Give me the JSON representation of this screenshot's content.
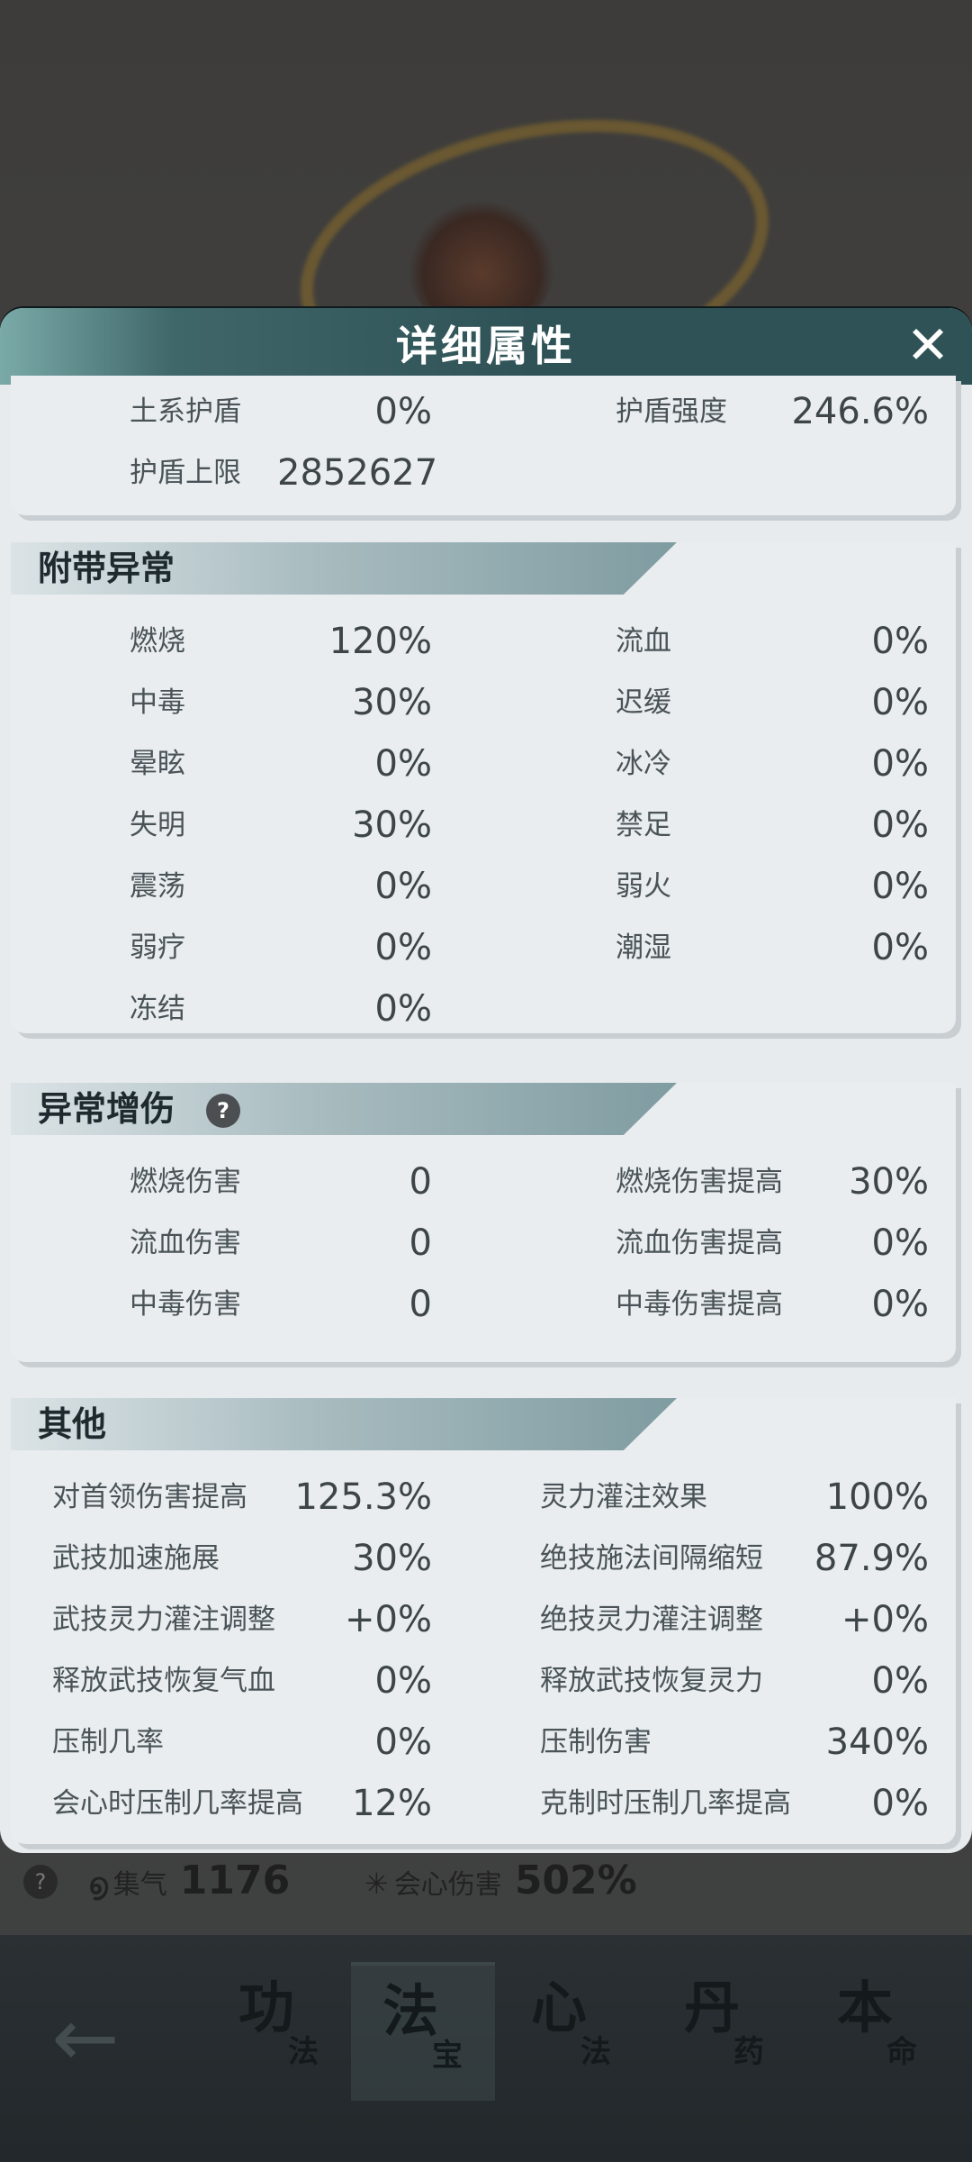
{
  "panel": {
    "title": "详细属性"
  },
  "shield": {
    "rows": [
      {
        "left_label": "土系护盾",
        "left_value": "0%",
        "right_label": "护盾强度",
        "right_value": "246.6%"
      },
      {
        "left_label": "护盾上限",
        "left_value": "2852627",
        "right_label": "",
        "right_value": ""
      }
    ]
  },
  "abnormal": {
    "title": "附带异常",
    "rows": [
      {
        "left_label": "燃烧",
        "left_value": "120%",
        "right_label": "流血",
        "right_value": "0%"
      },
      {
        "left_label": "中毒",
        "left_value": "30%",
        "right_label": "迟缓",
        "right_value": "0%"
      },
      {
        "left_label": "晕眩",
        "left_value": "0%",
        "right_label": "冰冷",
        "right_value": "0%"
      },
      {
        "left_label": "失明",
        "left_value": "30%",
        "right_label": "禁足",
        "right_value": "0%"
      },
      {
        "left_label": "震荡",
        "left_value": "0%",
        "right_label": "弱火",
        "right_value": "0%"
      },
      {
        "left_label": "弱疗",
        "left_value": "0%",
        "right_label": "潮湿",
        "right_value": "0%"
      },
      {
        "left_label": "冻结",
        "left_value": "0%",
        "right_label": "",
        "right_value": ""
      }
    ]
  },
  "abnormal_dmg": {
    "title": "异常增伤",
    "help": "?",
    "rows": [
      {
        "left_label": "燃烧伤害",
        "left_value": "0",
        "right_label": "燃烧伤害提高",
        "right_value": "30%"
      },
      {
        "left_label": "流血伤害",
        "left_value": "0",
        "right_label": "流血伤害提高",
        "right_value": "0%"
      },
      {
        "left_label": "中毒伤害",
        "left_value": "0",
        "right_label": "中毒伤害提高",
        "right_value": "0%"
      }
    ]
  },
  "other": {
    "title": "其他",
    "rows": [
      {
        "left_label": "对首领伤害提高",
        "left_value": "125.3%",
        "right_label": "灵力灌注效果",
        "right_value": "100%"
      },
      {
        "left_label": "武技加速施展",
        "left_value": "30%",
        "right_label": "绝技施法间隔缩短",
        "right_value": "87.9%"
      },
      {
        "left_label": "武技灵力灌注调整",
        "left_value": "+0%",
        "right_label": "绝技灵力灌注调整",
        "right_value": "+0%"
      },
      {
        "left_label": "释放武技恢复气血",
        "left_value": "0%",
        "right_label": "释放武技恢复灵力",
        "right_value": "0%"
      },
      {
        "left_label": "压制几率",
        "left_value": "0%",
        "right_label": "压制伤害",
        "right_value": "340%"
      },
      {
        "left_label": "会心时压制几率提高",
        "left_value": "12%",
        "right_label": "克制时压制几率提高",
        "right_value": "0%"
      }
    ]
  },
  "behind_stats": {
    "help": "?",
    "qi_label": "集气",
    "qi_value": "1176",
    "crit_label": "会心伤害",
    "crit_value": "502%"
  },
  "bottom_nav": {
    "tabs": [
      {
        "big": "功",
        "small": "法"
      },
      {
        "big": "法",
        "small": "宝"
      },
      {
        "big": "心",
        "small": "法"
      },
      {
        "big": "丹",
        "small": "药"
      },
      {
        "big": "本",
        "small": "命"
      }
    ]
  }
}
